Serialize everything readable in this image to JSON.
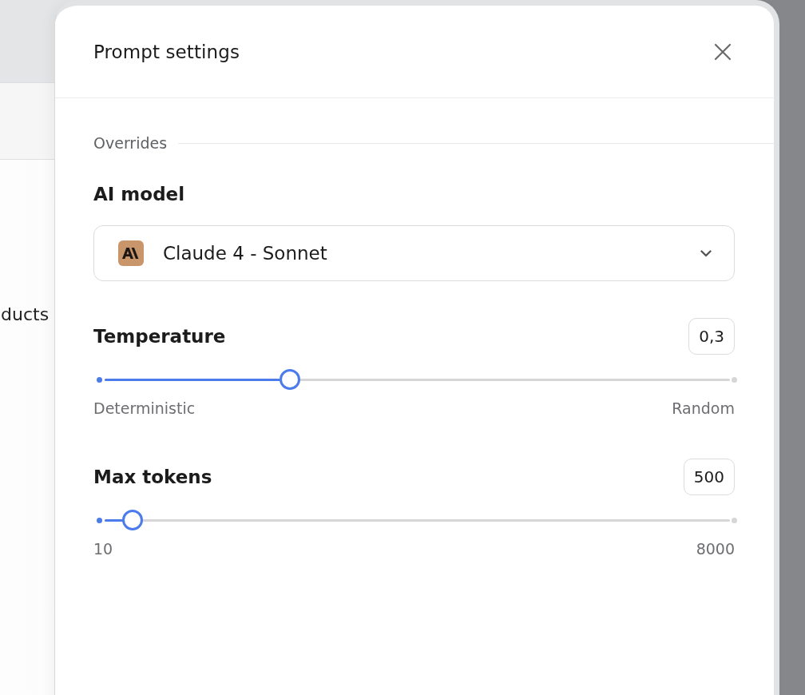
{
  "background": {
    "text": "ducts"
  },
  "panel": {
    "title": "Prompt settings",
    "section": "Overrides"
  },
  "model": {
    "label": "AI model",
    "value": "Claude 4 - Sonnet"
  },
  "sliders": [
    {
      "label": "Temperature",
      "value": "0,3",
      "level": 0.3,
      "min_label": "Deterministic",
      "max_label": "Random"
    },
    {
      "label": "Max tokens",
      "value": "500",
      "level": 0.053,
      "min_label": "10",
      "max_label": "8000"
    }
  ]
}
